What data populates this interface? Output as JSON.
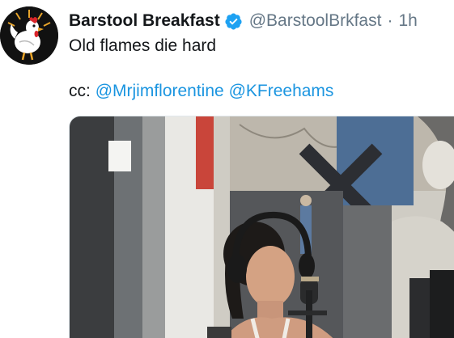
{
  "tweet": {
    "display_name": "Barstool Breakfast",
    "handle": "@BarstoolBrkfast",
    "separator": "·",
    "time": "1h",
    "text": "Old flames die hard",
    "cc_prefix": "cc:",
    "mentions": [
      "@Mrjimflorentine",
      "@KFreehams"
    ]
  },
  "icons": {
    "avatar": "rooster-logo",
    "verified": "verified-badge-icon"
  },
  "colors": {
    "link": "#1b95e0",
    "name": "#14171a",
    "secondary": "#657786",
    "verified": "#1da1f2"
  }
}
